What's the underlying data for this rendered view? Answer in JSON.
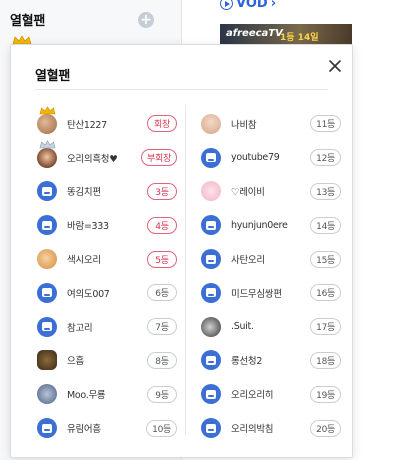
{
  "background": {
    "section_title": "열혈팬",
    "add_icon": "plus-icon",
    "vod_label": "VOD",
    "thumbnail_text": "afreecaTV",
    "thumbnail_sub": "1등 14일"
  },
  "popup": {
    "title": "열혈팬",
    "close_icon": "close-icon",
    "left_column": [
      {
        "nickname": "탄산1227",
        "rank": "회장",
        "avatar": "photo",
        "crown": "gold",
        "highlight": true
      },
      {
        "nickname": "오리의흑청♥",
        "rank": "부회장",
        "avatar": "photo",
        "crown": "silver",
        "highlight": true
      },
      {
        "nickname": "똥김치편",
        "rank": "3등",
        "avatar": "default",
        "highlight": true
      },
      {
        "nickname": "바람=333",
        "rank": "4등",
        "avatar": "default",
        "highlight": true
      },
      {
        "nickname": "색시오리",
        "rank": "5등",
        "avatar": "photo",
        "highlight": true
      },
      {
        "nickname": "여의도007",
        "rank": "6등",
        "avatar": "default",
        "highlight": false
      },
      {
        "nickname": "참고리",
        "rank": "7등",
        "avatar": "default",
        "highlight": false
      },
      {
        "nickname": "으흠",
        "rank": "8등",
        "avatar": "photo",
        "highlight": false
      },
      {
        "nickname": "Moo.무룡",
        "rank": "9등",
        "avatar": "photo",
        "highlight": false
      },
      {
        "nickname": "유림어흥",
        "rank": "10등",
        "avatar": "default",
        "highlight": false
      }
    ],
    "right_column": [
      {
        "nickname": "나비참",
        "rank": "11등",
        "avatar": "photo"
      },
      {
        "nickname": "youtube79",
        "rank": "12등",
        "avatar": "default"
      },
      {
        "nickname": "♡레이비",
        "rank": "13등",
        "avatar": "photo"
      },
      {
        "nickname": "hyunjun0ere",
        "rank": "14등",
        "avatar": "default"
      },
      {
        "nickname": "사탄오리",
        "rank": "15등",
        "avatar": "default"
      },
      {
        "nickname": "미드무심쌍편",
        "rank": "16등",
        "avatar": "default"
      },
      {
        "nickname": ".Suit.",
        "rank": "17등",
        "avatar": "photo"
      },
      {
        "nickname": "롱선청2",
        "rank": "18등",
        "avatar": "default"
      },
      {
        "nickname": "오리오리히",
        "rank": "19등",
        "avatar": "default"
      },
      {
        "nickname": "오리의박침",
        "rank": "20등",
        "avatar": "default"
      }
    ]
  },
  "colors": {
    "accent_red": "#d6324e",
    "default_avatar_blue": "#3b6fd6",
    "link_blue": "#2b63d9"
  }
}
